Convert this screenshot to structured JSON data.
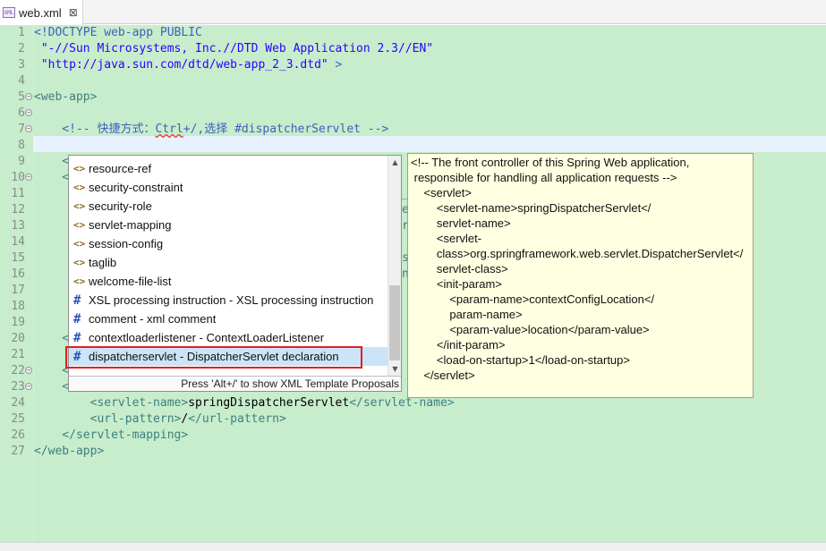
{
  "tab": {
    "title": "web.xml",
    "icon": "xml-file-icon",
    "close": "⊠"
  },
  "gutter": [
    "1",
    "2",
    "3",
    "4",
    "5",
    "6",
    "7",
    "8",
    "9",
    "10",
    "11",
    "12",
    "13",
    "14",
    "15",
    "16",
    "17",
    "18",
    "19",
    "20",
    "21",
    "22",
    "23",
    "24",
    "25",
    "26",
    "27"
  ],
  "code": {
    "l1a": "<!DOCTYPE web-app ",
    "l1b": "PUBLIC",
    "l2": " \"-//Sun Microsystems, Inc.//DTD Web Application 2.3//EN\"",
    "l3a": " \"http://java.sun.com/dtd/web-app_2_3.dtd\"",
    "l3b": " >",
    "l5": "<web-app>",
    "l7a": "    <!-- ",
    "l7b": "快捷方式：",
    "l7c": "Ctrl",
    "l7d": "+/,选择 #dispatcherServlet -->",
    "l9": "    <",
    "l10": "    <",
    "l20": "    <",
    "l22": "    <",
    "l23": "    <",
    "l24a": "        <servlet-name>",
    "l24b": "springDispatcherServlet",
    "l24c": "</servlet-name>",
    "l25a": "        <url-pattern>",
    "l25b": "/",
    "l25c": "</url-pattern>",
    "l26": "    </servlet-mapping>",
    "l27": "</web-app>",
    "frag_l11": "_",
    "frag_l12": "e",
    "frag_l13": "r",
    "frag_l14": "s",
    "frag_l15": "n"
  },
  "content_assist": {
    "items": [
      {
        "type": "element",
        "icon": "<>",
        "label": "resource-ref"
      },
      {
        "type": "element",
        "icon": "<>",
        "label": "security-constraint"
      },
      {
        "type": "element",
        "icon": "<>",
        "label": "security-role"
      },
      {
        "type": "element",
        "icon": "<>",
        "label": "servlet-mapping"
      },
      {
        "type": "element",
        "icon": "<>",
        "label": "session-config"
      },
      {
        "type": "element",
        "icon": "<>",
        "label": "taglib"
      },
      {
        "type": "element",
        "icon": "<>",
        "label": "welcome-file-list"
      },
      {
        "type": "template",
        "icon": "#",
        "label": "XSL processing instruction - XSL processing instruction"
      },
      {
        "type": "template",
        "icon": "#",
        "label": "comment - xml comment"
      },
      {
        "type": "template",
        "icon": "#",
        "label": "contextloaderlistener - ContextLoaderListener"
      },
      {
        "type": "template",
        "icon": "#",
        "label": "dispatcherservlet - DispatcherServlet declaration"
      }
    ],
    "selected_index": 10,
    "footer": "Press 'Alt+/' to show XML Template Proposals",
    "scroll_up": "▲",
    "scroll_down": "▼"
  },
  "info_popup": {
    "lines": [
      "<!-- The front controller of this Spring Web application,",
      " responsible for handling all application requests -->",
      "    <servlet>",
      "        <servlet-name>springDispatcherServlet</",
      "        servlet-name>",
      "        <servlet-",
      "        class>org.springframework.web.servlet.DispatcherServlet</",
      "        servlet-class>",
      "        <init-param>",
      "            <param-name>contextConfigLocation</",
      "            param-name>",
      "            <param-value>location</param-value>",
      "        </init-param>",
      "        <load-on-startup>1</load-on-startup>",
      "    </servlet>"
    ]
  },
  "colors": {
    "editor_bg": "#c7edcc",
    "tag": "#3f7f7f",
    "string": "#2a00ff",
    "comment": "#3f5fbf",
    "selection": "#cce4f7",
    "highlight_box": "#e02020",
    "info_bg": "#ffffe1"
  }
}
